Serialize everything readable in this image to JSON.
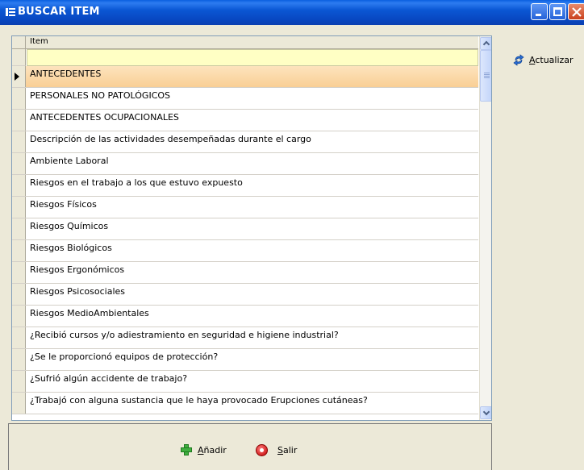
{
  "window": {
    "title": "BUSCAR ITEM"
  },
  "grid": {
    "column_header": "Item",
    "filter_value": "",
    "selected_index": 0,
    "rows": [
      "ANTECEDENTES",
      "PERSONALES NO PATOLÓGICOS",
      "ANTECEDENTES  OCUPACIONALES",
      "Descripción de las actividades desempeñadas durante el cargo",
      "Ambiente Laboral",
      "Riesgos en el trabajo a los que estuvo expuesto",
      "Riesgos Físicos",
      "Riesgos Químicos",
      "Riesgos Biológicos",
      "Riesgos Ergonómicos",
      "Riesgos Psicosociales",
      "Riesgos MedioAmbientales",
      "¿Recibió cursos y/o adiestramiento en seguridad e higiene industrial?",
      "¿Se le proporcionó equipos de protección?",
      "¿Sufrió algún accidente de trabajo?",
      "¿Trabajó con alguna sustancia que le haya provocado Erupciones cutáneas?"
    ]
  },
  "actions": {
    "refresh_label": "Actualizar",
    "add_label": "Añadir",
    "exit_label": "Salir"
  },
  "colors": {
    "titlebar": "#0846c0",
    "selected_row": "#f9cf95",
    "filter_row": "#ffffc4",
    "window_bg": "#ece9d8"
  }
}
